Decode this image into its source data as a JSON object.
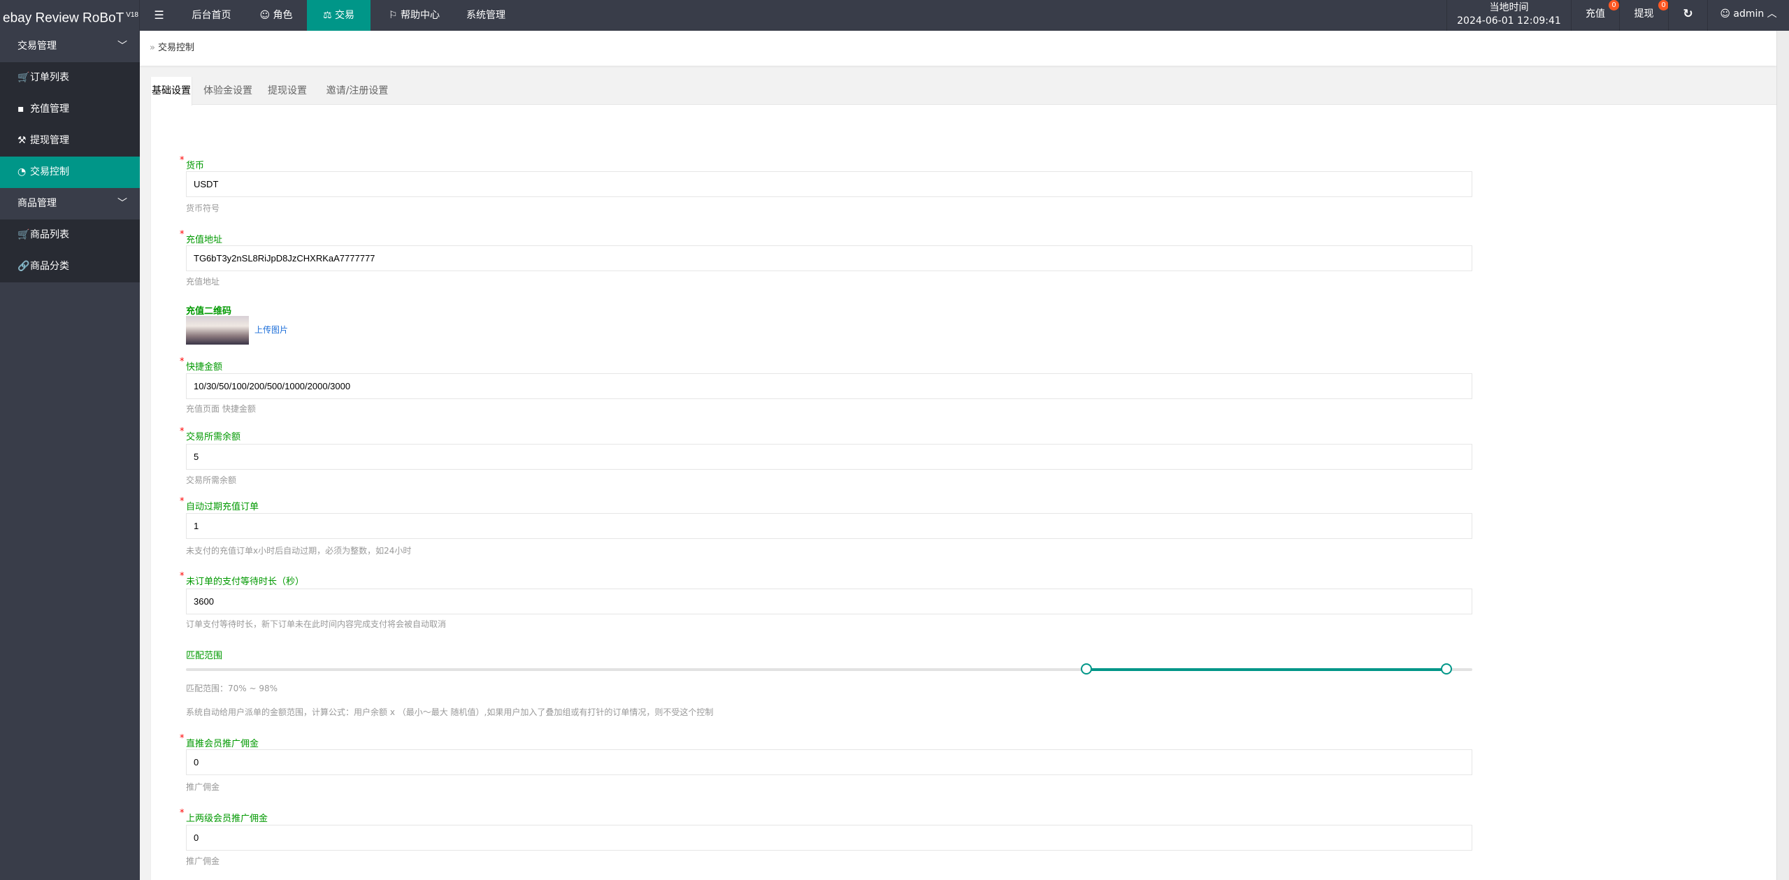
{
  "header": {
    "brand": "ebay Review RoBoT",
    "brand_version": "V18",
    "nav": [
      "后台首页",
      "角色",
      "交易",
      "帮助中心",
      "系统管理"
    ],
    "active_nav": "交易",
    "time_label": "当地时间",
    "time_value": "2024-06-01 12:09:41",
    "recharge_label": "充值",
    "recharge_badge": "0",
    "withdraw_label": "提现",
    "withdraw_badge": "0",
    "user": "admin"
  },
  "sidebar": {
    "groups": [
      {
        "label": "交易管理",
        "items": [
          "订单列表",
          "充值管理",
          "提现管理",
          "交易控制"
        ]
      },
      {
        "label": "商品管理",
        "items": [
          "商品列表",
          "商品分类"
        ]
      }
    ],
    "active_item": "交易控制"
  },
  "breadcrumb": "交易控制",
  "tabs": [
    "基础设置",
    "体验金设置",
    "提现设置",
    "邀请/注册设置"
  ],
  "active_tab": "基础设置",
  "form": {
    "currency": {
      "label": "货币",
      "value": "USDT",
      "help": "货币符号"
    },
    "address": {
      "label": "充值地址",
      "value": "TG6bT3y2nSL8RiJpD8JzCHXRKaA7777777",
      "help": "充值地址"
    },
    "qr": {
      "label": "充值二维码",
      "upload": "上传图片"
    },
    "quick": {
      "label": "快捷金额",
      "value": "10/30/50/100/200/500/1000/2000/3000",
      "help": "充值页面 快捷金额"
    },
    "balance": {
      "label": "交易所需余额",
      "value": "5",
      "help": "交易所需余额"
    },
    "expire": {
      "label": "自动过期充值订单",
      "value": "1",
      "help": "未支付的充值订单x小时后自动过期，必须为整数，如24小时"
    },
    "wait": {
      "label": "未订单的支付等待时长（秒）",
      "value": "3600",
      "help": "订单支付等待时长，新下订单未在此时间内容完成支付将会被自动取消"
    },
    "range": {
      "label": "匹配范围",
      "min": 70,
      "max": 98,
      "help": "匹配范围：70% ~ 98%",
      "desc": "系统自动给用户派单的金额范围，计算公式：用户余额 x （最小～最大 随机值）,如果用户加入了叠加组或有打针的订单情况，则不受这个控制"
    },
    "direct": {
      "label": "直推会员推广佣金",
      "value": "0",
      "help": "推广佣金"
    },
    "second": {
      "label": "上两级会员推广佣金",
      "value": "0",
      "help": "推广佣金"
    }
  },
  "colors": {
    "accent": "#009688",
    "topbar": "#393d49",
    "label": "#009900",
    "badge": "#ff5722"
  }
}
